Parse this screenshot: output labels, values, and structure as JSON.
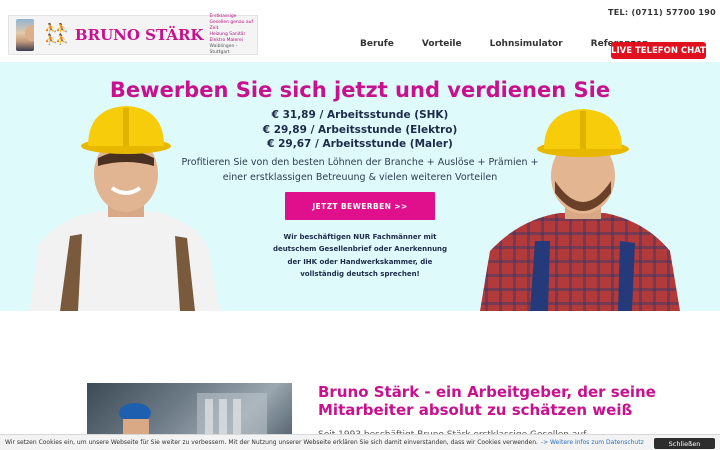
{
  "header": {
    "phone": "TEL: (0711) 57700 190",
    "logo": {
      "name": "BRUNO STÄRK",
      "tagline_line1": "Erstklassige Gesellen genau auf Zeit",
      "tagline_line2": "Heizung Sanitär Elektro Malerei",
      "tagline_line3": "Waiblingen - Stuttgart"
    },
    "nav": [
      "Berufe",
      "Vorteile",
      "Lohnsimulator",
      "Referenzen"
    ],
    "live_chat_label": "LIVE TELEFON CHAT"
  },
  "hero": {
    "title": "Bewerben Sie sich jetzt und verdienen Sie",
    "rates": [
      "€ 31,89 / Arbeitsstunde (SHK)",
      "€ 29,89 / Arbeitsstunde (Elektro)",
      "€ 29,67 / Arbeitsstunde (Maler)"
    ],
    "intro": "Profitieren Sie von den besten Löhnen der Branche + Auslöse + Prämien + einer erstklassigen Betreuung & vielen weiteren Vorteilen",
    "cta_label": "JETZT BEWERBEN >>",
    "note": "Wir beschäftigen NUR Fachmänner mit deutschem Gesellenbrief oder Anerkennung der IHK oder Handwerkskammer, die vollständig deutsch sprechen!"
  },
  "about": {
    "title": "Bruno Stärk - ein Arbeitgeber, der seine Mitarbeiter absolut zu schätzen weiß",
    "text_start": "Seit 1993 beschäftigt Bruno Stärk erstklassige Gesellen auf"
  },
  "cookie": {
    "text": "Wir setzen Cookies ein, um unsere Webseite für Sie weiter zu verbessern. Mit der Nutzung unserer Webseite erklären Sie sich damit einverstanden, dass wir Cookies verwenden.",
    "link_label": "-> Weitere Infos zum Datenschutz",
    "close_label": "Schließen"
  },
  "colors": {
    "brand_magenta": "#c8118c",
    "cta_magenta": "#e0108c",
    "live_red": "#e0101e",
    "hero_bg": "#dffafb"
  }
}
